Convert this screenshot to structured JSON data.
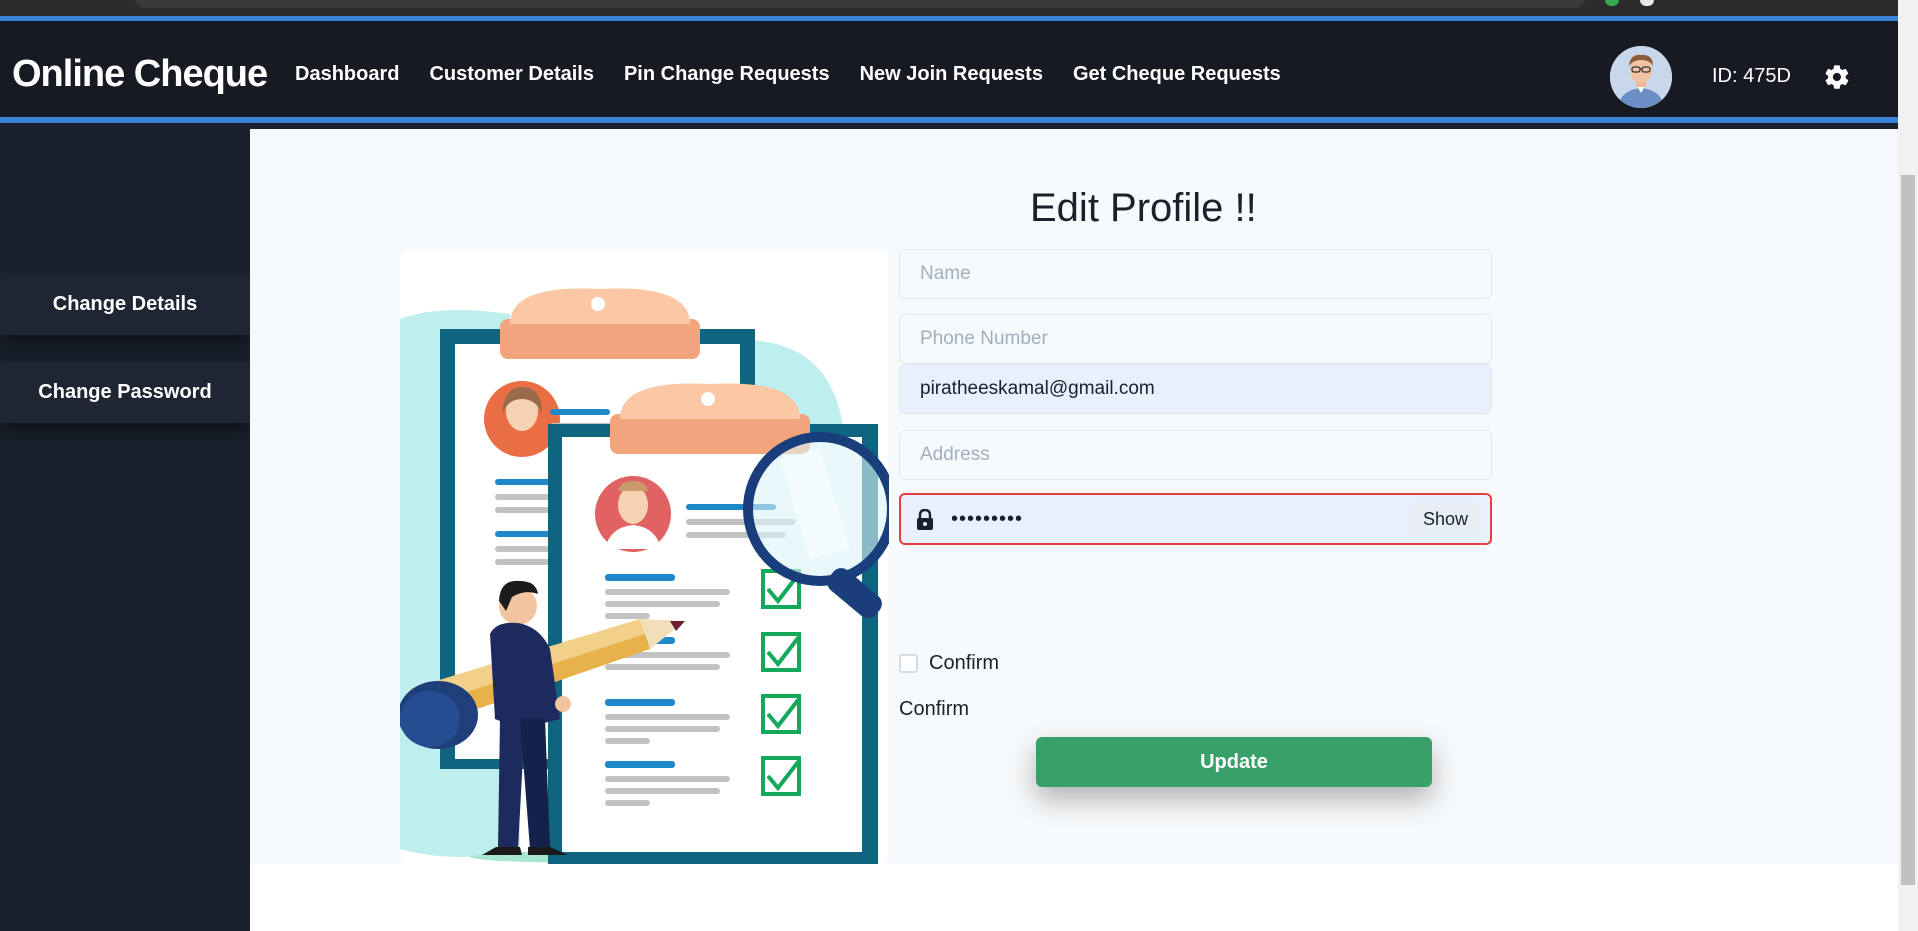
{
  "navbar": {
    "brand": "Online Cheque",
    "links": [
      "Dashboard",
      "Customer Details",
      "Pin Change Requests",
      "New Join Requests",
      "Get Cheque Requests"
    ],
    "user_id": "ID: 475D",
    "avatar_icon": "user-avatar",
    "settings_icon": "gear-icon"
  },
  "sidebar": {
    "items": [
      "Change Details",
      "Change Password"
    ]
  },
  "form": {
    "title": "Edit Profile !!",
    "name_placeholder": "Name",
    "phone_placeholder": "Phone Number",
    "email_value": "piratheeskamal@gmail.com",
    "address_placeholder": "Address",
    "password_masked": "•••••••••",
    "show_label": "Show",
    "confirm_checkbox_label": "Confirm",
    "confirm_text": "Confirm",
    "update_label": "Update"
  },
  "colors": {
    "navbar_bg": "#171923",
    "accent_blue": "#3b82d6",
    "sidebar_bg": "#1a202c",
    "main_bg": "#f7fafc",
    "update_green": "#38a169",
    "error_red": "#e53e3e"
  }
}
